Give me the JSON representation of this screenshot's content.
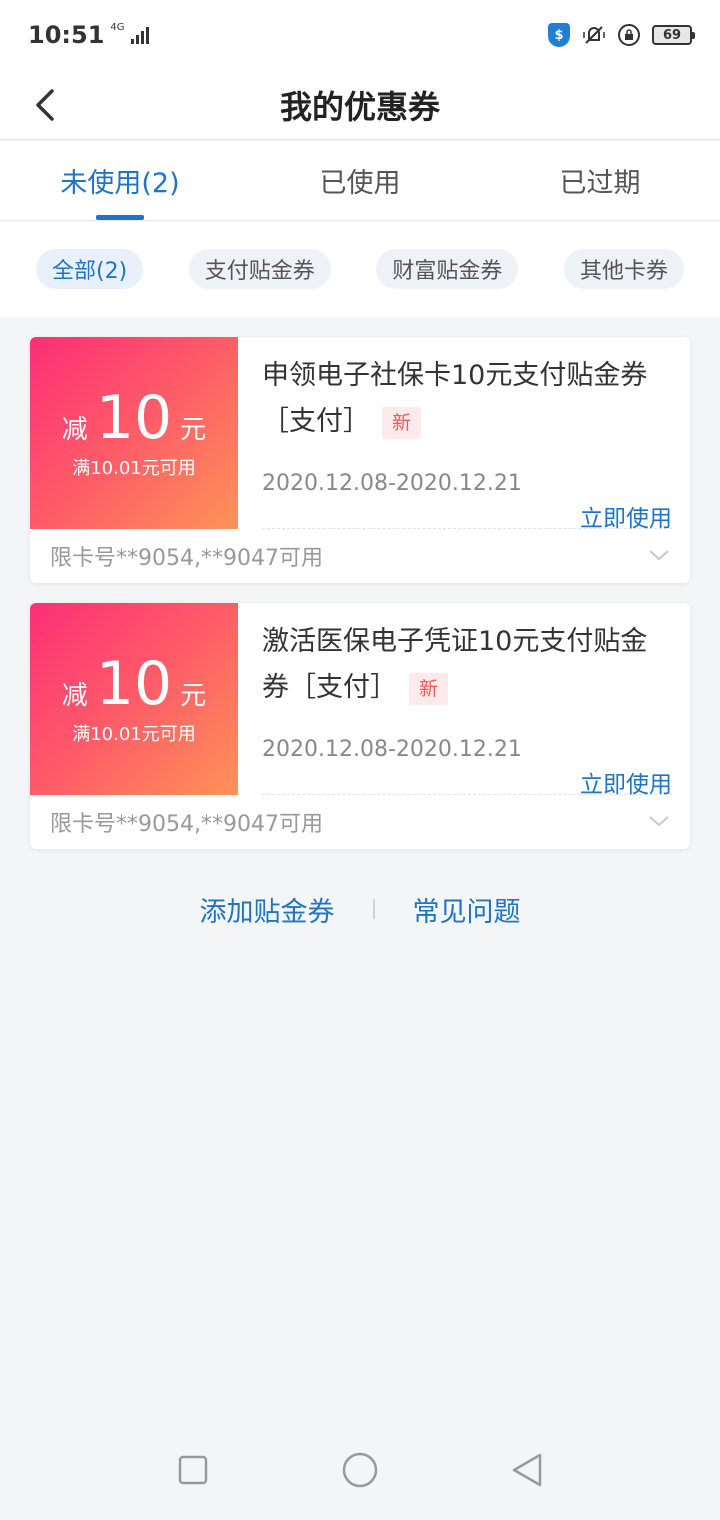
{
  "status_bar": {
    "time": "10:51",
    "network": "4G",
    "shield_symbol": "$",
    "battery": "69"
  },
  "header": {
    "title": "我的优惠券"
  },
  "tabs": [
    {
      "label": "未使用(2)",
      "active": true
    },
    {
      "label": "已使用",
      "active": false
    },
    {
      "label": "已过期",
      "active": false
    }
  ],
  "filters": [
    {
      "label": "全部(2)",
      "active": true
    },
    {
      "label": "支付贴金券",
      "active": false
    },
    {
      "label": "财富贴金券",
      "active": false
    },
    {
      "label": "其他卡券",
      "active": false
    }
  ],
  "coupons": [
    {
      "prefix": "减",
      "amount": "10",
      "unit": "元",
      "condition": "满10.01元可用",
      "title": "申领电子社保卡10元支付贴金券［支付］",
      "badge": "新",
      "date_range": "2020.12.08-2020.12.21",
      "action": "立即使用",
      "restriction": "限卡号**9054,**9047可用"
    },
    {
      "prefix": "减",
      "amount": "10",
      "unit": "元",
      "condition": "满10.01元可用",
      "title": "激活医保电子凭证10元支付贴金券［支付］",
      "badge": "新",
      "date_range": "2020.12.08-2020.12.21",
      "action": "立即使用",
      "restriction": "限卡号**9054,**9047可用"
    }
  ],
  "bottom_links": {
    "add": "添加贴金券",
    "faq": "常见问题"
  },
  "colors": {
    "accent": "#1f74c4",
    "coupon_gradient_start": "#fc2f77",
    "coupon_gradient_end": "#ff9357",
    "badge_text": "#ef5a5a"
  }
}
